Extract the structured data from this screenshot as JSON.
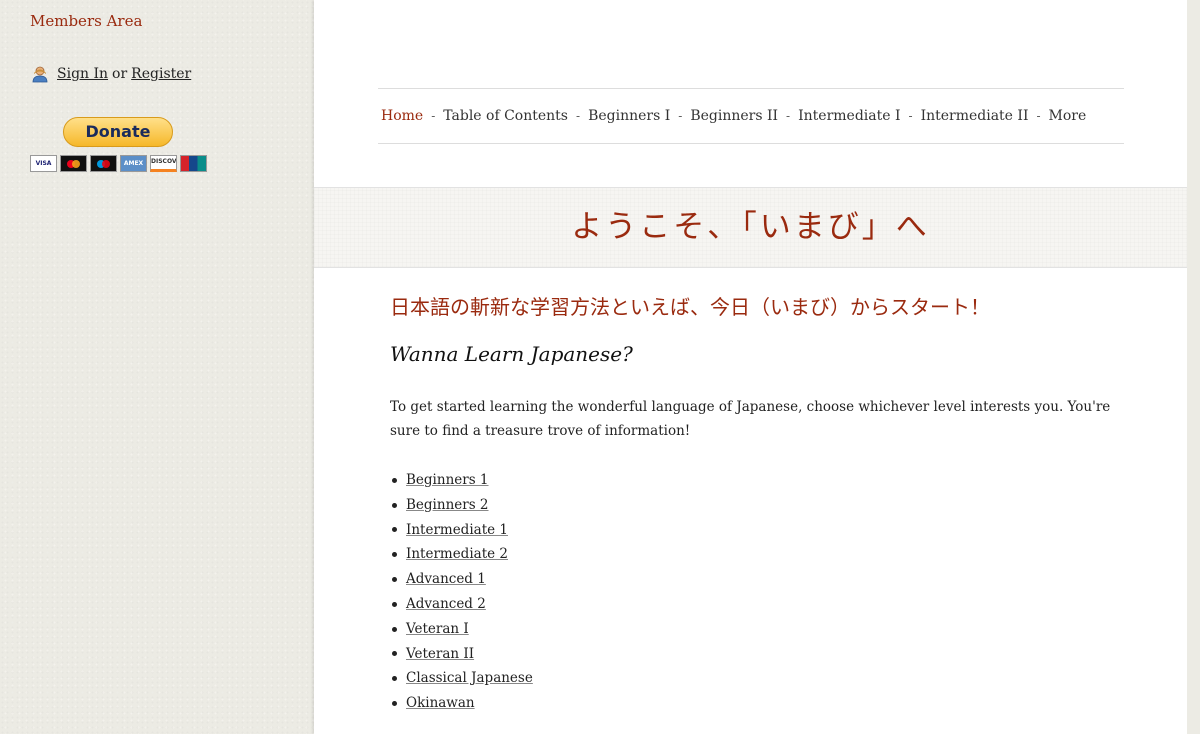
{
  "sidebar": {
    "members_title": "Members Area",
    "sign_in": "Sign In",
    "or_text": "or",
    "register": "Register",
    "donate_label": "Donate",
    "cards": [
      "VISA",
      "",
      "",
      "AMEX",
      "DISCOVER",
      ""
    ]
  },
  "nav": {
    "items": [
      "Home",
      "Table of Contents",
      "Beginners I",
      "Beginners II",
      "Intermediate I",
      "Intermediate II",
      "More"
    ],
    "separator": "-"
  },
  "banner": {
    "title": "ようこそ、「いまび」へ"
  },
  "content": {
    "subtitle": "日本語の斬新な学習方法といえば、今日（いまび）からスタート！",
    "heading": "Wanna Learn Japanese?",
    "intro": "To get started learning the wonderful language of Japanese, choose whichever level interests you. You're sure to find a treasure trove of information!",
    "levels": [
      "Beginners 1",
      "Beginners 2",
      "Intermediate 1",
      "Intermediate 2",
      "Advanced 1",
      "Advanced 2",
      "Veteran I",
      "Veteran II",
      "Classical Japanese",
      "Okinawan"
    ]
  },
  "colors": {
    "accent": "#9a2a0f",
    "sidebar_bg": "#ecebe4"
  }
}
